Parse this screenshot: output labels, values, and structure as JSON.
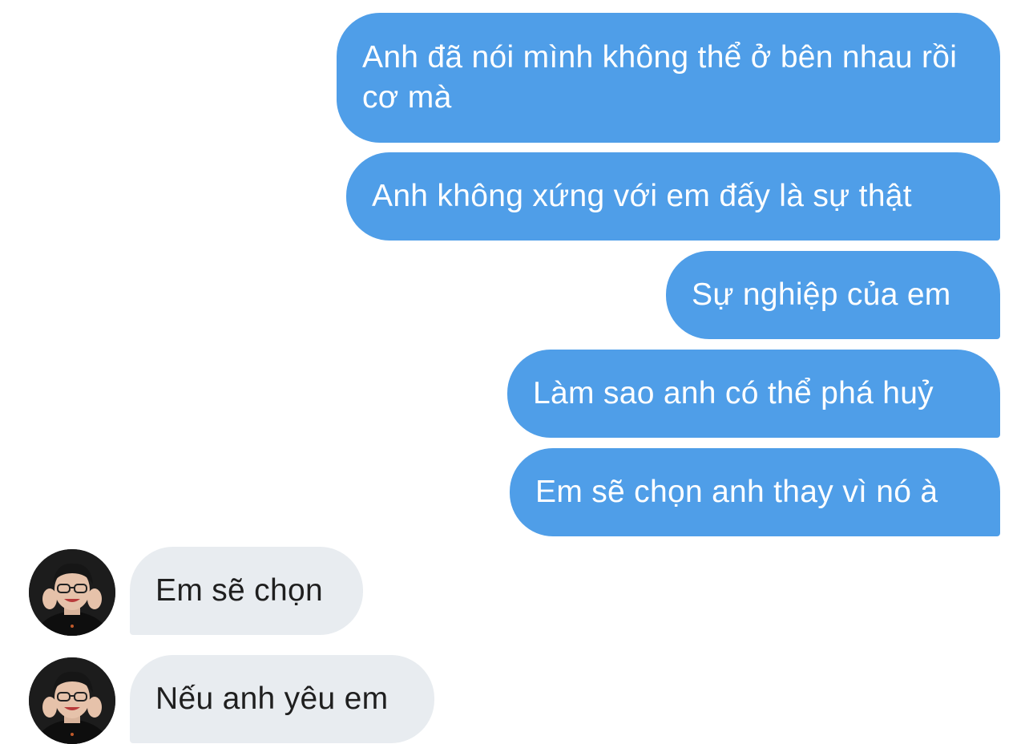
{
  "conversation": {
    "sent": [
      {
        "text": "Anh đã nói mình không thể ở bên nhau rồi cơ mà"
      },
      {
        "text": "Anh không xứng với em đấy là sự thật"
      },
      {
        "text": "Sự nghiệp của em"
      },
      {
        "text": "Làm sao anh có thể phá huỷ"
      },
      {
        "text": "Em sẽ chọn anh thay vì nó à"
      }
    ],
    "received": [
      {
        "text": "Em sẽ chọn",
        "avatar": "contact-avatar"
      },
      {
        "text": "Nếu anh yêu em",
        "avatar": "contact-avatar"
      }
    ]
  },
  "colors": {
    "sent_bubble": "#4f9ee8",
    "sent_text": "#ffffff",
    "received_bubble": "#e8ecf0",
    "received_text": "#1f1f1f",
    "background": "#ffffff"
  }
}
